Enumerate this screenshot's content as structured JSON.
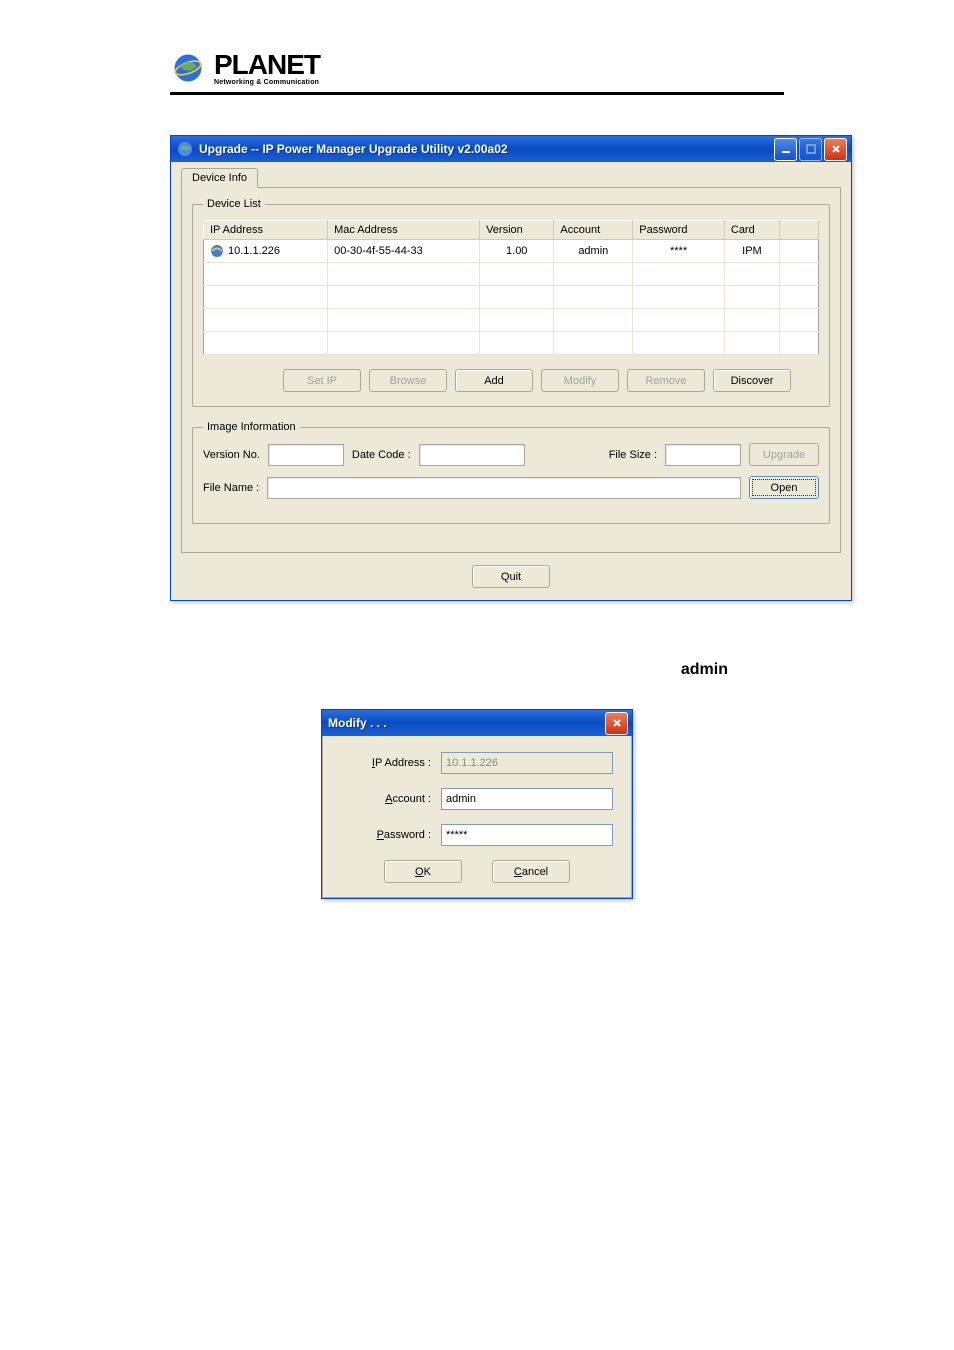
{
  "logo": {
    "name": "PLANET",
    "tagline": "Networking & Communication"
  },
  "mainWindow": {
    "title": "Upgrade -- IP Power Manager Upgrade Utility v2.00a02",
    "tabs": {
      "deviceInfo": "Device Info"
    },
    "deviceList": {
      "legend": "Device List",
      "headers": {
        "ip": "IP Address",
        "mac": "Mac Address",
        "version": "Version",
        "account": "Account",
        "password": "Password",
        "card": "Card"
      },
      "rows": [
        {
          "ip": "10.1.1.226",
          "mac": "00-30-4f-55-44-33",
          "version": "1.00",
          "account": "admin",
          "password": "****",
          "card": "IPM"
        }
      ],
      "buttons": {
        "setIp": "Set IP",
        "browse": "Browse",
        "add": "Add",
        "modify": "Modify",
        "remove": "Remove",
        "discover": "Discover"
      }
    },
    "imageInfo": {
      "legend": "Image Information",
      "labels": {
        "versionNo": "Version No.",
        "dateCode": "Date Code :",
        "fileSize": "File Size :",
        "fileName": "File Name :"
      },
      "buttons": {
        "upgrade": "Upgrade",
        "open": "Open"
      }
    },
    "quit": "Quit"
  },
  "floatingText": {
    "admin": "admin"
  },
  "modifyDialog": {
    "title": "Modify . . .",
    "labels": {
      "ip": "IP Address :",
      "account": "Account :",
      "password": "Password :"
    },
    "values": {
      "ip": "10.1.1.226",
      "account": "admin",
      "password": "*****"
    },
    "buttons": {
      "ok": "OK",
      "cancel": "Cancel"
    }
  }
}
